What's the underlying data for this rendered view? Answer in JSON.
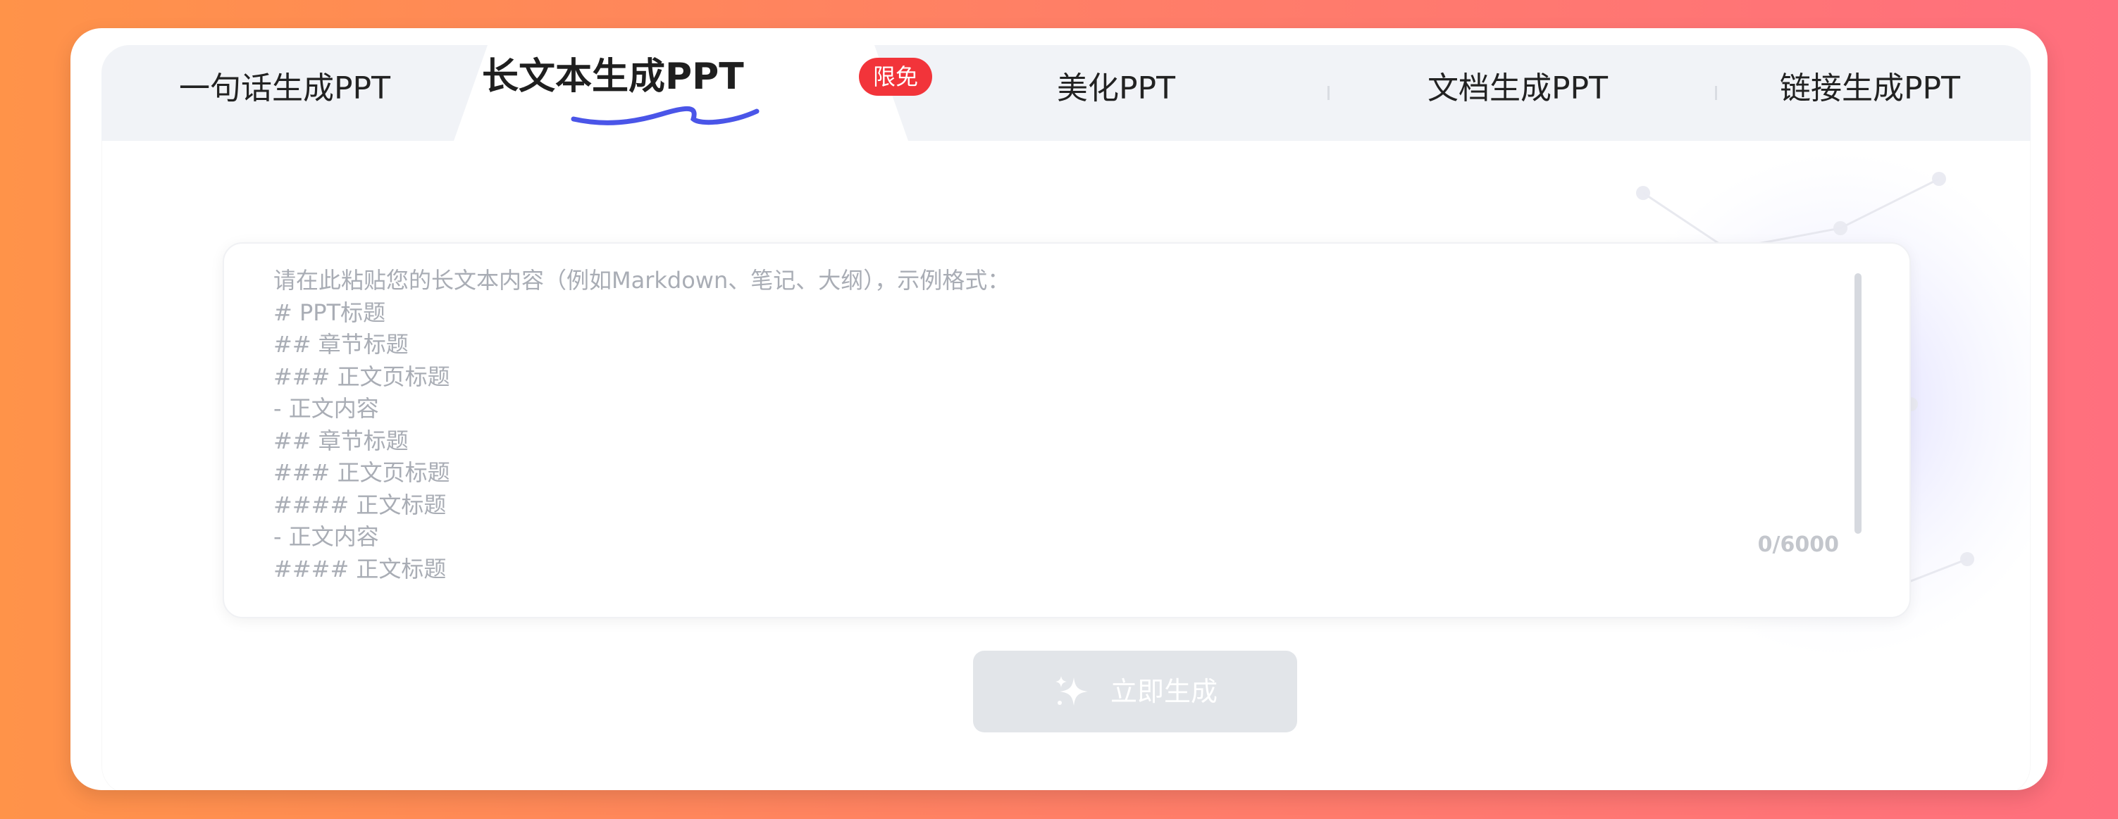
{
  "tabs": [
    {
      "label": "一句话生成PPT"
    },
    {
      "label": "长文本生成PPT",
      "badge": "限免",
      "active": true
    },
    {
      "label": "美化PPT"
    },
    {
      "label": "文档生成PPT"
    },
    {
      "label": "链接生成PPT"
    }
  ],
  "editor": {
    "placeholder": "请在此粘贴您的长文本内容（例如Markdown、笔记、大纲），示例格式：\n# PPT标题\n## 章节标题\n### 正文页标题\n- 正文内容\n## 章节标题\n### 正文页标题\n#### 正文标题\n- 正文内容\n#### 正文标题",
    "counter": "0/6000"
  },
  "generate_button": {
    "label": "立即生成",
    "icon": "sparkle-icon"
  },
  "colors": {
    "accent": "#4a55e8",
    "badge": "#f2343a",
    "button_disabled": "#e2e5e9"
  }
}
